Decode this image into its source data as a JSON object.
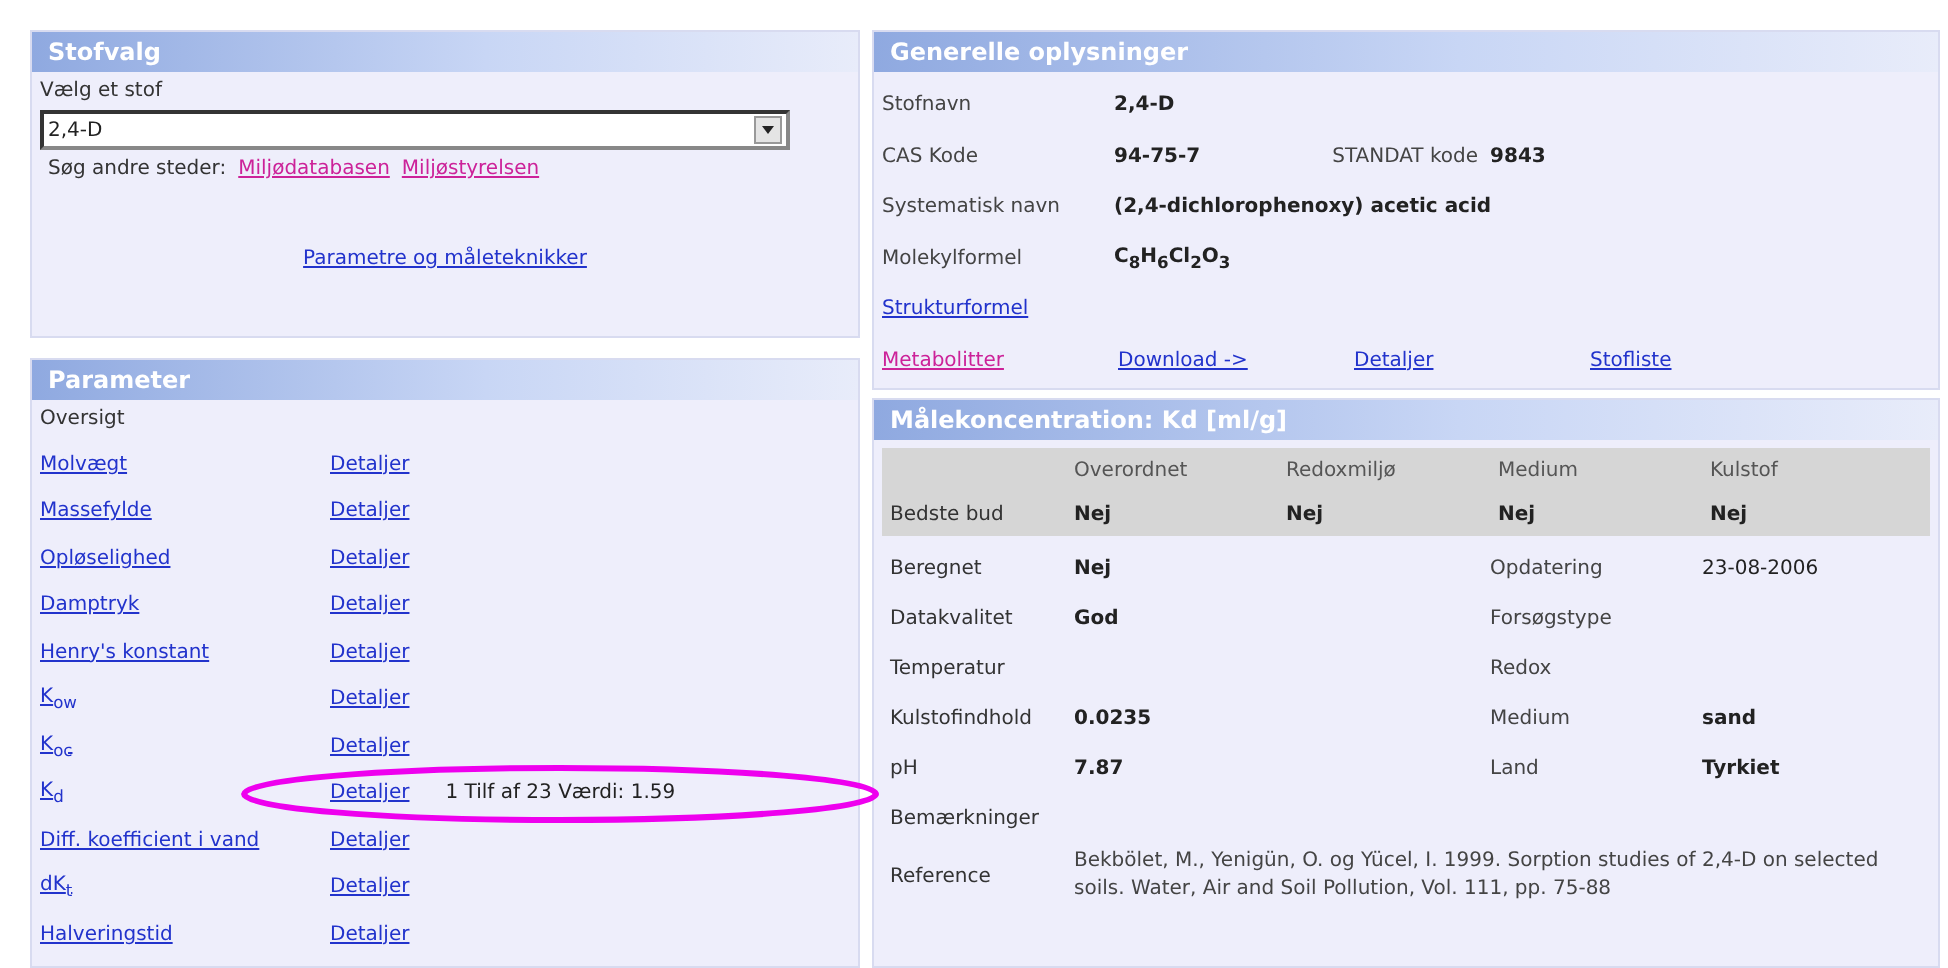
{
  "substance_panel": {
    "title": "Stofvalg",
    "select_label": "Vælg et stof",
    "select_value": "2,4-D",
    "search_label": "Søg andre steder:",
    "search_links": [
      {
        "label": "Miljødatabasen",
        "visited": true
      },
      {
        "label": "Miljøstyrelsen",
        "visited": true
      }
    ],
    "bottom_link": {
      "label": "Parametre og måleteknikker",
      "visited": false
    }
  },
  "general_panel": {
    "title": "Generelle oplysninger",
    "rows": [
      {
        "label": "Stofnavn",
        "value": "2,4-D"
      },
      {
        "label": "CAS Kode",
        "value": "94-75-7",
        "extra_label": "STANDAT kode",
        "extra_value": "9843"
      },
      {
        "label": "Systematisk navn",
        "value": "(2,4-dichlorophenoxy) acetic acid"
      },
      {
        "label": "Molekylformel",
        "value": "C$_{8}$H$_{6}$Cl$_{2}$O$_{3}$"
      }
    ],
    "structure_link": {
      "label": "Strukturformel",
      "visited": false
    },
    "bottom_links": [
      {
        "label": "Metabolitter",
        "visited": true
      },
      {
        "label": "Download ->",
        "visited": false
      },
      {
        "label": "Detaljer",
        "visited": false
      },
      {
        "label": "Stofliste",
        "visited": false
      }
    ]
  },
  "parameter_panel": {
    "title": "Parameter",
    "overview": "Oversigt",
    "rows": [
      {
        "name": "Molvægt",
        "details": "Detaljer"
      },
      {
        "name": "Massefylde",
        "details": "Detaljer"
      },
      {
        "name": "Opløselighed",
        "details": "Detaljer"
      },
      {
        "name": "Damptryk",
        "details": "Detaljer"
      },
      {
        "name": "Henry's konstant",
        "details": "Detaljer"
      },
      {
        "name": "K$_{ow}$",
        "details": "Detaljer"
      },
      {
        "name": "K$_{oc}$",
        "details": "Detaljer"
      },
      {
        "name": "K$_{d}$",
        "details": "Detaljer",
        "note": "1 Tilf af 23 Værdi: 1.59"
      },
      {
        "name": "Diff. koefficient i vand",
        "details": "Detaljer"
      },
      {
        "name": "dK$_{t}$",
        "details": "Detaljer"
      },
      {
        "name": "Halveringstid",
        "details": "Detaljer"
      }
    ]
  },
  "kd_panel": {
    "title": "Målekoncentration: Kd [ml/g]",
    "best_table": {
      "columns": [
        "Overordnet",
        "Redoxmiljø",
        "Medium",
        "Kulstof"
      ],
      "row_label": "Bedste bud",
      "values": [
        "Nej",
        "Nej",
        "Nej",
        "Nej"
      ]
    },
    "rows": [
      {
        "label": "Beregnet",
        "value": "Nej",
        "label2": "Opdatering",
        "value2": "23-08-2006"
      },
      {
        "label": "Datakvalitet",
        "value": "God",
        "label2": "Forsøgstype"
      },
      {
        "label": "Temperatur",
        "label2": "Redox"
      },
      {
        "label": "Kulstofindhold",
        "value": "0.0235",
        "label2": "Medium",
        "value2": "sand"
      },
      {
        "label": "pH",
        "value": "7.87",
        "label2": "Land",
        "value2": "Tyrkiet"
      },
      {
        "label": "Bemærkninger"
      }
    ],
    "reference_label": "Reference",
    "reference": "Bekbölet, M., Yenigün, O. og Yücel, I. 1999. Sorption studies of 2,4-D on selected soils. Water, Air and Soil Pollution, Vol. 111, pp. 75-88"
  }
}
